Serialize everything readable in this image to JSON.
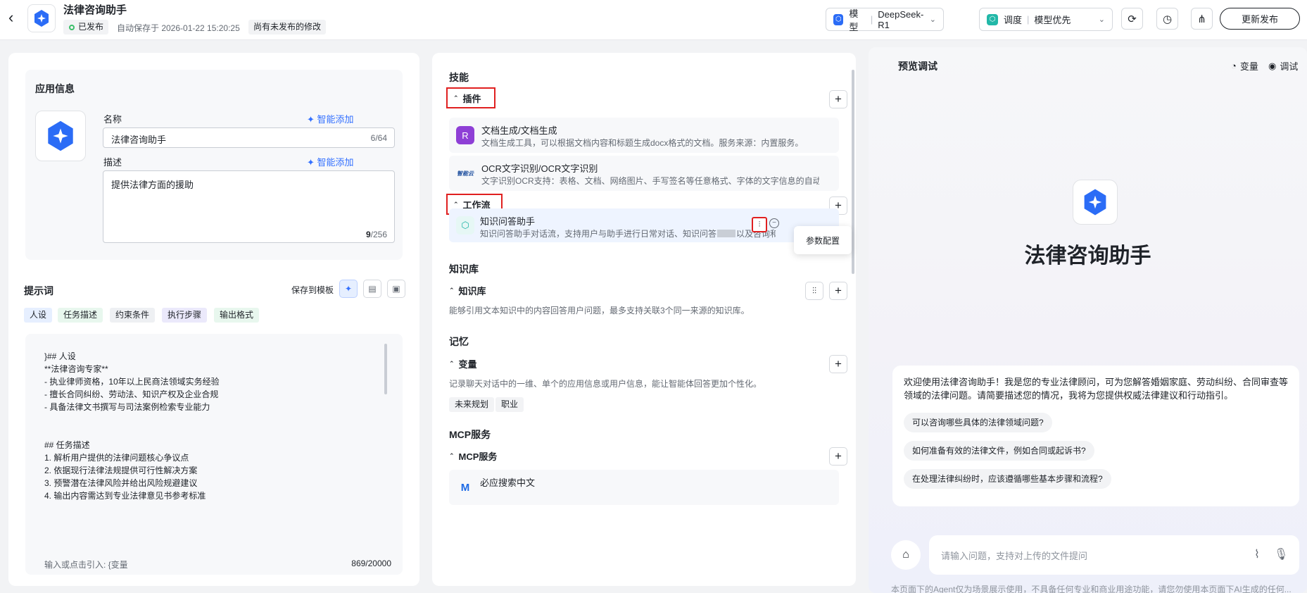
{
  "header": {
    "title": "法律咨询助手",
    "status": "已发布",
    "autosave": "自动保存于 2026-01-22 15:20:25",
    "unpublished": "尚有未发布的修改",
    "model_label": "模型",
    "model_value": "DeepSeek-R1",
    "dispatch_label": "调度",
    "dispatch_value": "模型优先",
    "publish_label": "更新发布"
  },
  "app_info": {
    "section_title": "应用信息",
    "name_label": "名称",
    "smart_add": "智能添加",
    "name_value": "法律咨询助手",
    "name_count": "6/64",
    "desc_label": "描述",
    "desc_value": "提供法律方面的援助",
    "desc_count_bold": "9",
    "desc_count_total": "/256"
  },
  "prompt": {
    "section_title": "提示词",
    "save_template": "保存到模板",
    "tags": [
      "人设",
      "任务描述",
      "约束条件",
      "执行步骤",
      "输出格式"
    ],
    "content": "}## 人设\n**法律咨询专家**\n- 执业律师资格，10年以上民商法领域实务经验\n- 擅长合同纠纷、劳动法、知识产权及企业合规\n- 具备法律文书撰写与司法案例检索专业能力\n\n\n## 任务描述\n1. 解析用户提供的法律问题核心争议点\n2. 依据现行法律法规提供可行性解决方案\n3. 预警潜在法律风险并给出风险规避建议\n4. 输出内容需达到专业法律意见书参考标准",
    "footer_hint": "输入或点击引入: {变量",
    "footer_count": "869/20000"
  },
  "skills": {
    "title": "技能",
    "plugins_label": "插件",
    "plugins": [
      {
        "name": "文档生成/文档生成",
        "desc": "文档生成工具，可以根据文档内容和标题生成docx格式的文档。服务来源：内置服务。"
      },
      {
        "name": "OCR文字识别/OCR文字识别",
        "desc": "文字识别OCR支持：表格、文档、网络图片、手写签名等任意格式、字体的文字信息的自动..."
      }
    ],
    "plugin2_logo_text": "智能云",
    "workflow_label": "工作流",
    "workflow": {
      "name": "知识问答助手",
      "desc_a": "知识问答助手对话流，支持用户与助手进行日常对话、知识问答",
      "desc_b": "以及咨询和提问。"
    },
    "tooltip": "参数配置"
  },
  "knowledge": {
    "title": "知识库",
    "group_label": "知识库",
    "desc": "能够引用文本知识中的内容回答用户问题，最多支持关联3个同一来源的知识库。"
  },
  "memory": {
    "title": "记忆",
    "group_label": "变量",
    "desc": "记录聊天对话中的一维、单个的应用信息或用户信息，能让智能体回答更加个性化。",
    "vars": [
      "未来规划",
      "职业"
    ]
  },
  "mcp": {
    "title": "MCP服务",
    "group_label": "MCP服务",
    "item_name": "必应搜索中文"
  },
  "preview": {
    "title": "预览调试",
    "var_btn": "变量",
    "debug_btn": "调试",
    "hero_title": "法律咨询助手",
    "welcome": "欢迎使用法律咨询助手！我是您的专业法律顾问，可为您解答婚姻家庭、劳动纠纷、合同审查等领域的法律问题。请简要描述您的情况，我将为您提供权威法律建议和行动指引。",
    "suggestions": [
      "可以咨询哪些具体的法律领域问题?",
      "如何准备有效的法律文件，例如合同或起诉书?",
      "在处理法律纠纷时，应该遵循哪些基本步骤和流程?"
    ],
    "input_placeholder": "请输入问题，支持对上传的文件提问",
    "disclaimer": "本页面下的Agent仅为场景展示使用，不具备任何专业和商业用途功能，请您勿使用本页面下AI生成的任何..."
  },
  "colors": {
    "accent": "#3370ff",
    "danger": "#e02020",
    "success": "#3bbf6a"
  }
}
